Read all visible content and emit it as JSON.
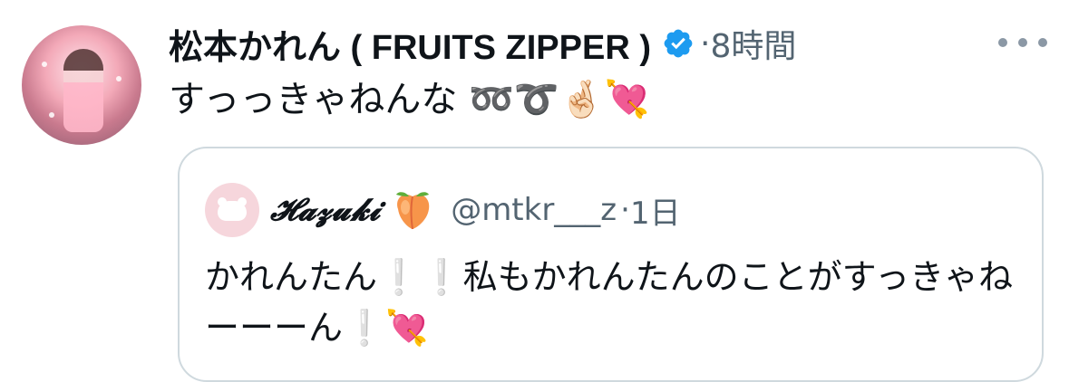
{
  "tweet": {
    "display_name": "松本かれん ( FRUITS ZIPPER )",
    "verified_icon": "verified-badge-icon",
    "separator": "·",
    "time": "8時間",
    "more_icon": "more-options-icon",
    "text": "すっっきゃねんな ➿➰🤞🏻💘"
  },
  "quote": {
    "author_name": "𝓗𝓪𝔃𝓾𝓴𝓲",
    "author_emoji_icon": "peach-icon",
    "handle": "@mtkr___z",
    "separator": "·",
    "time": "1日",
    "text": "かれんたん❕❕私もかれんたんのことがすっきゃねーーーん❕💘"
  },
  "colors": {
    "text_primary": "#0f1419",
    "text_secondary": "#536471",
    "verified_blue": "#1d9bf0",
    "quote_border": "#cfd9de"
  }
}
